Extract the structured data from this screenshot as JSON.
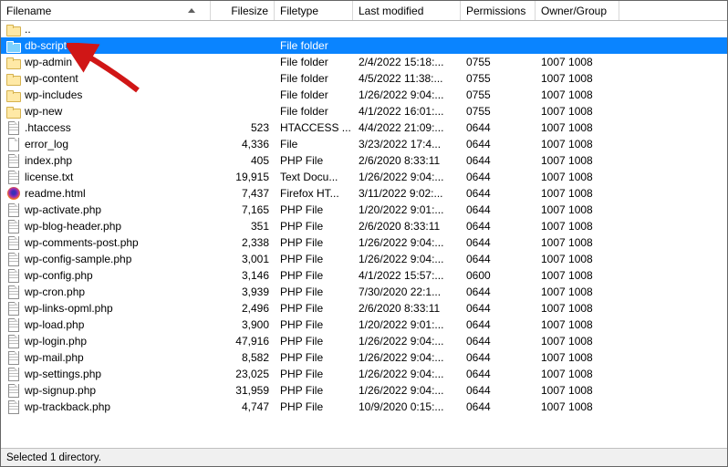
{
  "columns": {
    "filename": "Filename",
    "filesize": "Filesize",
    "filetype": "Filetype",
    "modified": "Last modified",
    "permissions": "Permissions",
    "owner": "Owner/Group"
  },
  "rows": [
    {
      "icon": "folder",
      "name": "..",
      "size": "",
      "type": "",
      "modified": "",
      "permissions": "",
      "owner": "",
      "selected": false
    },
    {
      "icon": "folder",
      "name": "db-script",
      "size": "",
      "type": "File folder",
      "modified": "",
      "permissions": "",
      "owner": "",
      "selected": true
    },
    {
      "icon": "folder",
      "name": "wp-admin",
      "size": "",
      "type": "File folder",
      "modified": "2/4/2022 15:18:...",
      "permissions": "0755",
      "owner": "1007 1008",
      "selected": false
    },
    {
      "icon": "folder",
      "name": "wp-content",
      "size": "",
      "type": "File folder",
      "modified": "4/5/2022 11:38:...",
      "permissions": "0755",
      "owner": "1007 1008",
      "selected": false
    },
    {
      "icon": "folder",
      "name": "wp-includes",
      "size": "",
      "type": "File folder",
      "modified": "1/26/2022 9:04:...",
      "permissions": "0755",
      "owner": "1007 1008",
      "selected": false
    },
    {
      "icon": "folder",
      "name": "wp-new",
      "size": "",
      "type": "File folder",
      "modified": "4/1/2022 16:01:...",
      "permissions": "0755",
      "owner": "1007 1008",
      "selected": false
    },
    {
      "icon": "file-lines",
      "name": ".htaccess",
      "size": "523",
      "type": "HTACCESS ...",
      "modified": "4/4/2022 21:09:...",
      "permissions": "0644",
      "owner": "1007 1008",
      "selected": false
    },
    {
      "icon": "file",
      "name": "error_log",
      "size": "4,336",
      "type": "File",
      "modified": "3/23/2022 17:4...",
      "permissions": "0644",
      "owner": "1007 1008",
      "selected": false
    },
    {
      "icon": "file-lines",
      "name": "index.php",
      "size": "405",
      "type": "PHP File",
      "modified": "2/6/2020 8:33:11",
      "permissions": "0644",
      "owner": "1007 1008",
      "selected": false
    },
    {
      "icon": "file-lines",
      "name": "license.txt",
      "size": "19,915",
      "type": "Text Docu...",
      "modified": "1/26/2022 9:04:...",
      "permissions": "0644",
      "owner": "1007 1008",
      "selected": false
    },
    {
      "icon": "firefox",
      "name": "readme.html",
      "size": "7,437",
      "type": "Firefox HT...",
      "modified": "3/11/2022 9:02:...",
      "permissions": "0644",
      "owner": "1007 1008",
      "selected": false
    },
    {
      "icon": "file-lines",
      "name": "wp-activate.php",
      "size": "7,165",
      "type": "PHP File",
      "modified": "1/20/2022 9:01:...",
      "permissions": "0644",
      "owner": "1007 1008",
      "selected": false
    },
    {
      "icon": "file-lines",
      "name": "wp-blog-header.php",
      "size": "351",
      "type": "PHP File",
      "modified": "2/6/2020 8:33:11",
      "permissions": "0644",
      "owner": "1007 1008",
      "selected": false
    },
    {
      "icon": "file-lines",
      "name": "wp-comments-post.php",
      "size": "2,338",
      "type": "PHP File",
      "modified": "1/26/2022 9:04:...",
      "permissions": "0644",
      "owner": "1007 1008",
      "selected": false
    },
    {
      "icon": "file-lines",
      "name": "wp-config-sample.php",
      "size": "3,001",
      "type": "PHP File",
      "modified": "1/26/2022 9:04:...",
      "permissions": "0644",
      "owner": "1007 1008",
      "selected": false
    },
    {
      "icon": "file-lines",
      "name": "wp-config.php",
      "size": "3,146",
      "type": "PHP File",
      "modified": "4/1/2022 15:57:...",
      "permissions": "0600",
      "owner": "1007 1008",
      "selected": false
    },
    {
      "icon": "file-lines",
      "name": "wp-cron.php",
      "size": "3,939",
      "type": "PHP File",
      "modified": "7/30/2020 22:1...",
      "permissions": "0644",
      "owner": "1007 1008",
      "selected": false
    },
    {
      "icon": "file-lines",
      "name": "wp-links-opml.php",
      "size": "2,496",
      "type": "PHP File",
      "modified": "2/6/2020 8:33:11",
      "permissions": "0644",
      "owner": "1007 1008",
      "selected": false
    },
    {
      "icon": "file-lines",
      "name": "wp-load.php",
      "size": "3,900",
      "type": "PHP File",
      "modified": "1/20/2022 9:01:...",
      "permissions": "0644",
      "owner": "1007 1008",
      "selected": false
    },
    {
      "icon": "file-lines",
      "name": "wp-login.php",
      "size": "47,916",
      "type": "PHP File",
      "modified": "1/26/2022 9:04:...",
      "permissions": "0644",
      "owner": "1007 1008",
      "selected": false
    },
    {
      "icon": "file-lines",
      "name": "wp-mail.php",
      "size": "8,582",
      "type": "PHP File",
      "modified": "1/26/2022 9:04:...",
      "permissions": "0644",
      "owner": "1007 1008",
      "selected": false
    },
    {
      "icon": "file-lines",
      "name": "wp-settings.php",
      "size": "23,025",
      "type": "PHP File",
      "modified": "1/26/2022 9:04:...",
      "permissions": "0644",
      "owner": "1007 1008",
      "selected": false
    },
    {
      "icon": "file-lines",
      "name": "wp-signup.php",
      "size": "31,959",
      "type": "PHP File",
      "modified": "1/26/2022 9:04:...",
      "permissions": "0644",
      "owner": "1007 1008",
      "selected": false
    },
    {
      "icon": "file-lines",
      "name": "wp-trackback.php",
      "size": "4,747",
      "type": "PHP File",
      "modified": "10/9/2020 0:15:...",
      "permissions": "0644",
      "owner": "1007 1008",
      "selected": false
    }
  ],
  "status": "Selected 1 directory."
}
